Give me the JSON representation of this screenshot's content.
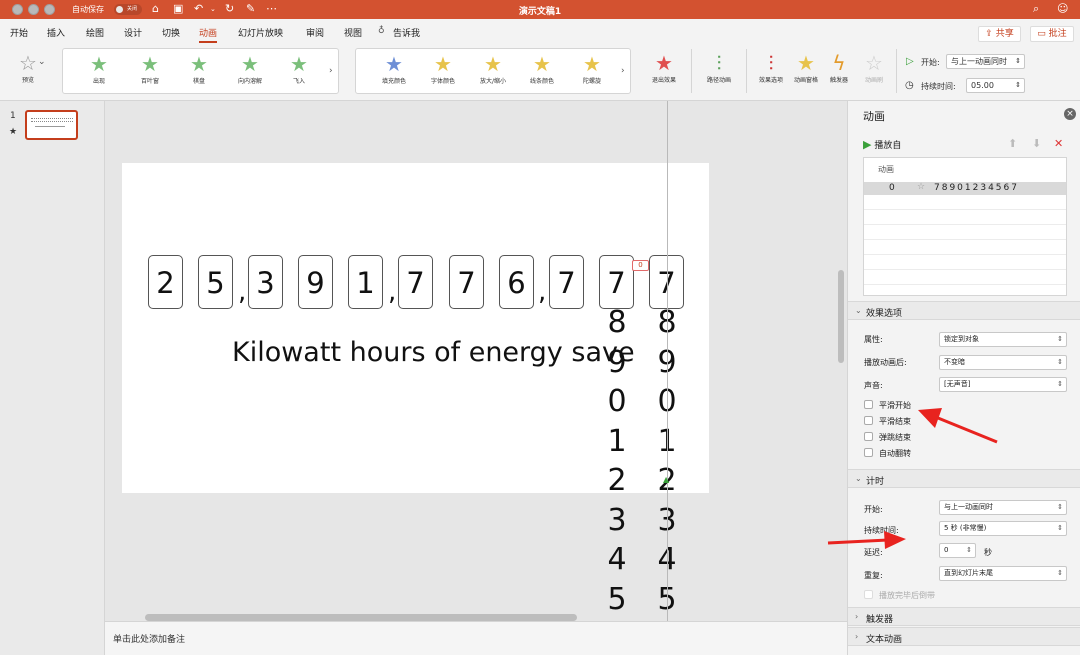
{
  "titlebar": {
    "autosave_label": "自动保存",
    "autosave_state": "关闭",
    "doc_title": "演示文稿1"
  },
  "tabs": [
    "开始",
    "插入",
    "绘图",
    "设计",
    "切换",
    "动画",
    "幻灯片放映",
    "审阅",
    "视图"
  ],
  "active_tab": "动画",
  "tell_me": "告诉我",
  "share_label": "共享",
  "comments_label": "批注",
  "ribbon": {
    "preview": "预览",
    "entrance": [
      "出现",
      "百叶窗",
      "棋盘",
      "向内溶解",
      "飞入"
    ],
    "emphasis": [
      "填充颜色",
      "字体颜色",
      "放大/缩小",
      "线条颜色",
      "陀螺旋"
    ],
    "exit": "退出效果",
    "path": "路径动画",
    "effect_options": "效果选项",
    "animation_pane": "动画窗格",
    "trigger": "触发器",
    "animate_brush": "动画刷",
    "start_label": "开始:",
    "start_value": "与上一动画同时",
    "duration_label": "持续时间:",
    "duration_value": "05.00"
  },
  "thumbnail": {
    "number": "1",
    "star": "★"
  },
  "slide": {
    "digits": [
      "2",
      "5",
      "3",
      "9",
      "1",
      "7",
      "7",
      "6",
      "7",
      "7",
      "7"
    ],
    "roll_col1": [
      "8",
      "9",
      "0",
      "1",
      "2",
      "3",
      "4",
      "5"
    ],
    "roll_col2": [
      "8",
      "9",
      "0",
      "1",
      "2",
      "3",
      "4",
      "5"
    ],
    "caption": "Kilowatt hours of energy save",
    "badge": "0"
  },
  "notes_placeholder": "单击此处添加备注",
  "pane": {
    "title": "动画",
    "play_from": "播放自",
    "list_header": "动画",
    "item_index": "0",
    "item_text": "78901234567",
    "effect_section": "效果选项",
    "attr_label": "属性:",
    "attr_value": "锁定到对象",
    "after_label": "播放动画后:",
    "after_value": "不变暗",
    "sound_label": "声音:",
    "sound_value": "[无声音]",
    "smooth_start": "平滑开始",
    "smooth_end": "平滑结束",
    "bounce_end": "弹跳结束",
    "auto_reverse": "自动翻转",
    "timing_section": "计时",
    "start_label": "开始:",
    "start_value": "与上一动画同时",
    "duration_label": "持续时间:",
    "duration_value": "5 秒 (非常慢)",
    "delay_label": "延迟:",
    "delay_value": "0",
    "delay_unit": "秒",
    "repeat_label": "重复:",
    "repeat_value": "直到幻灯片末尾",
    "rewind": "播放完毕后倒带",
    "trigger_section": "触发器",
    "text_anim_section": "文本动画"
  },
  "annotation_color": "#e8231f",
  "accent_color": "#d35230"
}
